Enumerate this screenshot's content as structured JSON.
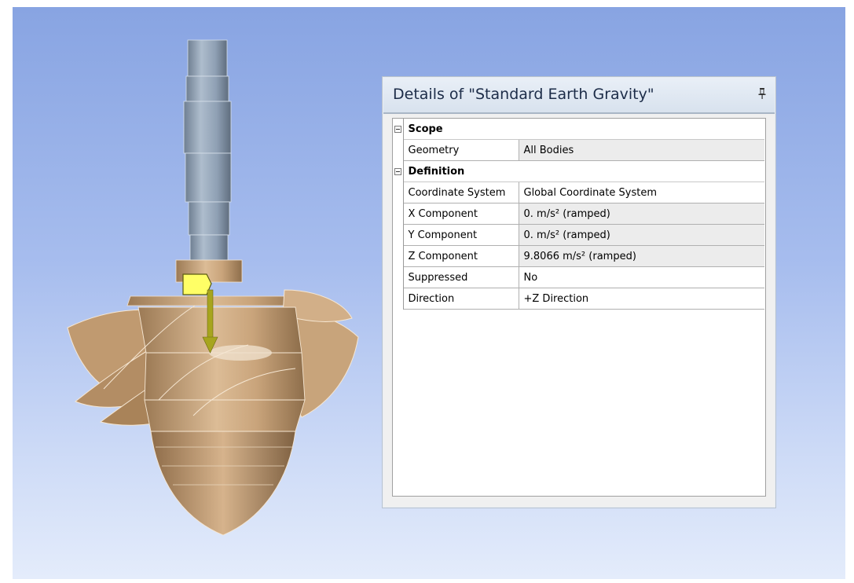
{
  "details": {
    "title": "Details of \"Standard Earth Gravity\"",
    "pin_icon": "pin-icon",
    "groups": [
      {
        "name": "Scope",
        "toggle_icon": "collapse-minus-icon",
        "properties": [
          {
            "name": "Geometry",
            "value": "All Bodies"
          }
        ]
      },
      {
        "name": "Definition",
        "toggle_icon": "collapse-minus-icon",
        "properties": [
          {
            "name": "Coordinate System",
            "value": "Global Coordinate System"
          },
          {
            "name": "X Component",
            "value": "0. m/s²  (ramped)"
          },
          {
            "name": "Y Component",
            "value": "0. m/s²  (ramped)"
          },
          {
            "name": "Z Component",
            "value": "9.8066 m/s²  (ramped)"
          },
          {
            "name": "Suppressed",
            "value": "No"
          },
          {
            "name": "Direction",
            "value": "+Z Direction"
          }
        ]
      }
    ]
  },
  "viewport": {
    "background_top": "#88a4e2",
    "background_bottom": "#e4ecfb",
    "model_color": "#d7b48f",
    "gravity_marker_color": "#ffff66",
    "gravity_arrow_color": "#a7a51e"
  }
}
